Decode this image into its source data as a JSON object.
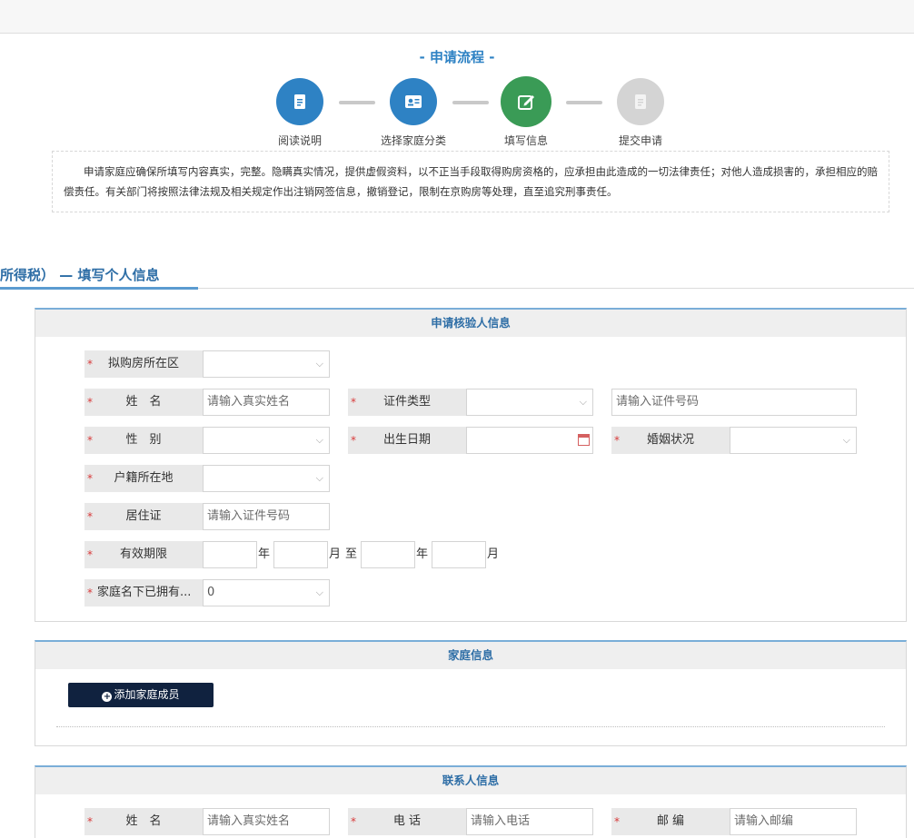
{
  "flow": {
    "title": "- 申请流程 -",
    "steps": [
      {
        "label": "阅读说明",
        "icon": "document-icon",
        "status": "done"
      },
      {
        "label": "选择家庭分类",
        "icon": "id-card-icon",
        "status": "done"
      },
      {
        "label": "填写信息",
        "icon": "edit-icon",
        "status": "current"
      },
      {
        "label": "提交申请",
        "icon": "document-icon",
        "status": "pending"
      }
    ]
  },
  "notice": "申请家庭应确保所填写内容真实，完整。隐瞒真实情况，提供虚假资料，以不正当手段取得购房资格的，应承担由此造成的一切法律责任；对他人造成损害的，承担相应的赔偿责任。有关部门将按照法律法规及相关规定作出注销网签信息，撤销登记，限制在京购房等处理，直至追究刑事责任。",
  "section_tab": "所得税）  — 填写个人信息",
  "applicant": {
    "title": "申请核验人信息",
    "district": {
      "label": "拟购房所在区",
      "value": ""
    },
    "name": {
      "label": "姓　名",
      "placeholder": "请输入真实姓名"
    },
    "id_type": {
      "label": "证件类型",
      "value": ""
    },
    "id_number": {
      "placeholder": "请输入证件号码"
    },
    "gender": {
      "label": "性　别",
      "value": ""
    },
    "birth_date": {
      "label": "出生日期",
      "value": ""
    },
    "marital": {
      "label": "婚姻状况",
      "value": ""
    },
    "hukou": {
      "label": "户籍所在地",
      "value": ""
    },
    "residence_permit": {
      "label": "居住证",
      "placeholder": "请输入证件号码"
    },
    "validity": {
      "label": "有效期限",
      "year": "年",
      "month": "月",
      "to": "至"
    },
    "owned": {
      "label": "家庭名下已拥有...",
      "value": "0"
    }
  },
  "family": {
    "title": "家庭信息",
    "add_button": "添加家庭成员"
  },
  "contact": {
    "title": "联系人信息",
    "name": {
      "label": "姓　名",
      "placeholder": "请输入真实姓名"
    },
    "phone": {
      "label": "电 话",
      "placeholder": "请输入电话"
    },
    "zip": {
      "label": "邮 编",
      "placeholder": "请输入邮编"
    }
  },
  "colors": {
    "accent": "#2e82c4",
    "current_step": "#3a9b56",
    "pending_step": "#d4d4d4",
    "required": "#d83a3a",
    "button": "#10223f"
  }
}
